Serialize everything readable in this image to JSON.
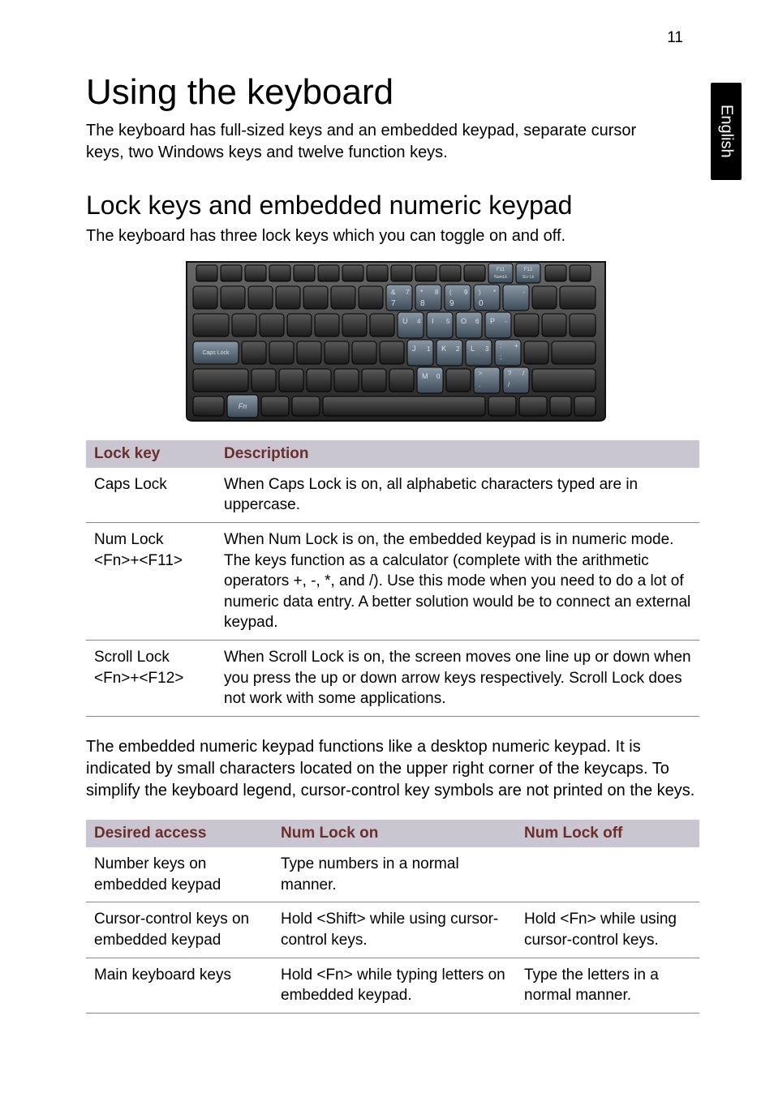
{
  "pageNumber": "11",
  "sideTab": "English",
  "h1": "Using the keyboard",
  "intro": "The keyboard has full-sized keys and an embedded keypad, separate cursor keys, two Windows keys and twelve function keys.",
  "h2": "Lock keys and embedded numeric keypad",
  "sub": "The keyboard has three lock keys which you can toggle on and off.",
  "table1": {
    "headers": {
      "c1": "Lock key",
      "c2": "Description"
    },
    "rows": [
      {
        "c1": "Caps Lock",
        "c2": "When Caps Lock is on, all alphabetic characters typed are in uppercase."
      },
      {
        "c1": "Num Lock <Fn>+<F11>",
        "c2": "When Num Lock is on, the embedded keypad is in numeric mode. The keys function as a calculator (complete with the arithmetic operators +, -, *, and /). Use this mode when you need to do a lot of numeric data entry. A better solution would be to connect an external keypad."
      },
      {
        "c1": "Scroll Lock <Fn>+<F12>",
        "c2": "When Scroll Lock is on, the screen moves one line up or down when you press the up or down arrow keys respectively. Scroll Lock does not work with some applications."
      }
    ]
  },
  "para2": "The embedded numeric keypad functions like a desktop numeric keypad. It is indicated by small characters located on the upper right corner of the keycaps. To simplify the keyboard legend, cursor-control key symbols are not printed on the keys.",
  "table2": {
    "headers": {
      "c1": "Desired access",
      "c2": "Num Lock on",
      "c3": "Num Lock off"
    },
    "rows": [
      {
        "c1": "Number keys on embedded keypad",
        "c2": "Type numbers in a normal manner.",
        "c3": ""
      },
      {
        "c1": "Cursor-control keys on embedded keypad",
        "c2": "Hold <Shift> while using cursor-control keys.",
        "c3": "Hold <Fn> while using cursor-control keys."
      },
      {
        "c1": "Main keyboard keys",
        "c2": "Hold <Fn> while typing letters on embedded keypad.",
        "c3": "Type the letters in a normal manner."
      }
    ]
  },
  "keyboard": {
    "capsLockLabel": "Caps Lock",
    "fnLabel": "Fn",
    "f11a": "F11",
    "f11b": "NumLk",
    "f12a": "F12",
    "f12b": "Scr Lk"
  }
}
